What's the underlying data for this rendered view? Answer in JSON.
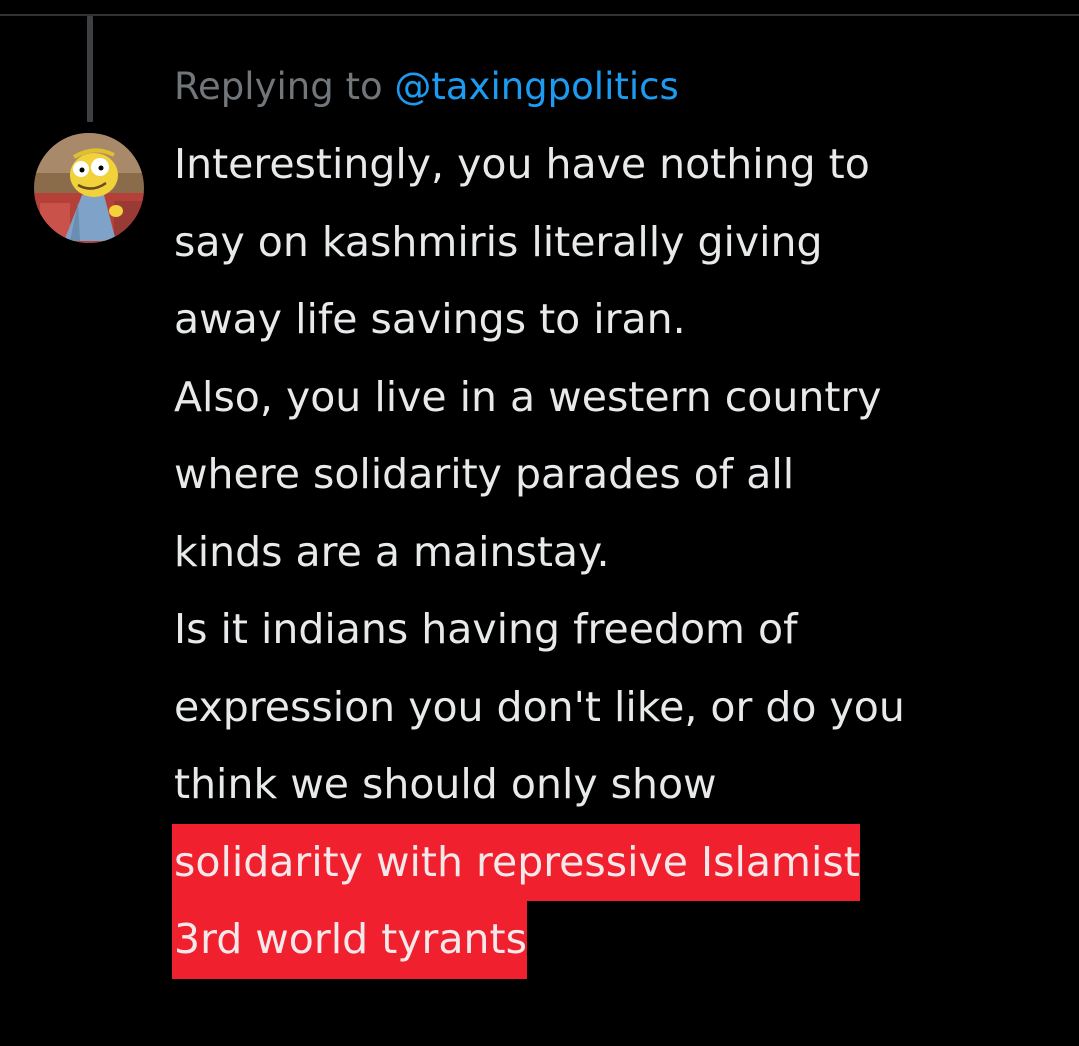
{
  "reply": {
    "prefix": "Replying to",
    "handle": "@taxingpolitics"
  },
  "tweet": {
    "lines": [
      "Interestingly, you have nothing to",
      "say on kashmiris literally giving",
      "away life savings to iran.",
      "Also, you live in a western country",
      "where solidarity parades of all",
      "kinds are a mainstay.",
      "Is it indians having freedom of",
      "expression you don't like, or do you",
      "think we should only show"
    ],
    "highlighted_lines": [
      "solidarity with repressive Islamist",
      "3rd world tyrants"
    ]
  },
  "colors": {
    "background": "#000000",
    "text": "#e7e9ea",
    "muted": "#71767b",
    "link": "#1d9bf0",
    "highlight": "#f0202f",
    "thread_line": "#3e4144"
  },
  "avatar": {
    "icon": "cartoon-character-avatar"
  }
}
